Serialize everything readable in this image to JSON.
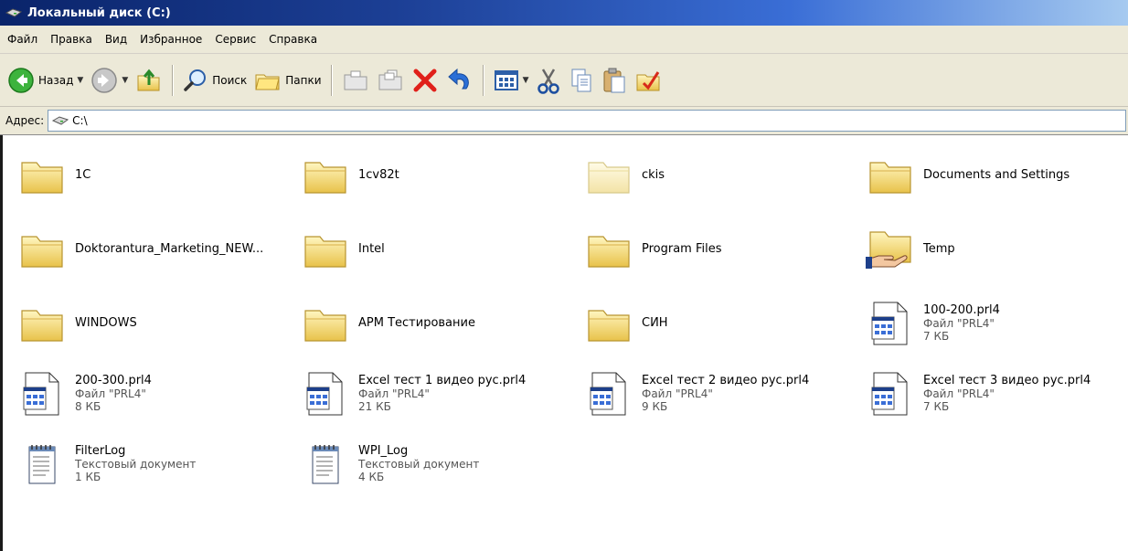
{
  "window": {
    "title": "Локальный диск (C:)"
  },
  "menu": [
    "Файл",
    "Правка",
    "Вид",
    "Избранное",
    "Сервис",
    "Справка"
  ],
  "toolbar": {
    "back_label": "Назад",
    "search_label": "Поиск",
    "folders_label": "Папки"
  },
  "address": {
    "label": "Адрес:",
    "value": "C:\\"
  },
  "items": [
    {
      "name": "1C",
      "kind": "folder"
    },
    {
      "name": "1cv82t",
      "kind": "folder"
    },
    {
      "name": "ckis",
      "kind": "folder-hidden"
    },
    {
      "name": "Documents and Settings",
      "kind": "folder"
    },
    {
      "name": "Doktorantura_Marketing_NEW...",
      "kind": "folder"
    },
    {
      "name": "Intel",
      "kind": "folder"
    },
    {
      "name": "Program Files",
      "kind": "folder"
    },
    {
      "name": "Temp",
      "kind": "folder-shared"
    },
    {
      "name": "WINDOWS",
      "kind": "folder"
    },
    {
      "name": "АРМ Тестирование",
      "kind": "folder"
    },
    {
      "name": "СИН",
      "kind": "folder"
    },
    {
      "name": "100-200.prl4",
      "kind": "prl4",
      "type": "Файл \"PRL4\"",
      "size": "7 КБ"
    },
    {
      "name": "200-300.prl4",
      "kind": "prl4",
      "type": "Файл \"PRL4\"",
      "size": "8 КБ"
    },
    {
      "name": "Excel тест 1 видео рус.prl4",
      "kind": "prl4",
      "type": "Файл \"PRL4\"",
      "size": "21 КБ"
    },
    {
      "name": "Excel тест 2 видео рус.prl4",
      "kind": "prl4",
      "type": "Файл \"PRL4\"",
      "size": "9 КБ"
    },
    {
      "name": "Excel тест 3 видео рус.prl4",
      "kind": "prl4",
      "type": "Файл \"PRL4\"",
      "size": "7 КБ"
    },
    {
      "name": "FilterLog",
      "kind": "txt",
      "type": "Текстовый документ",
      "size": "1 КБ"
    },
    {
      "name": "WPI_Log",
      "kind": "txt",
      "type": "Текстовый документ",
      "size": "4 КБ"
    }
  ]
}
